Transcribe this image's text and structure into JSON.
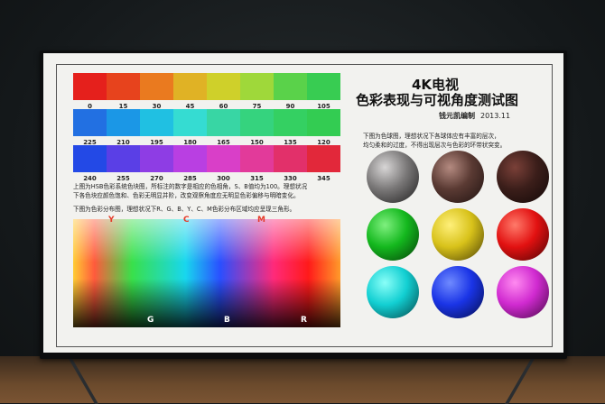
{
  "chart": {
    "title_line1": "4K电视",
    "title_line2": "色彩表现与可视角度测试图",
    "author": "钱元凯编制",
    "date": "2013.11"
  },
  "hue_bars": {
    "row1": {
      "labels": [
        "0",
        "15",
        "30",
        "45",
        "60",
        "75",
        "90",
        "105"
      ],
      "colors": [
        "#e5201c",
        "#e7431d",
        "#ea7a1f",
        "#e0b225",
        "#cfd02a",
        "#9fd83a",
        "#5ad24a",
        "#38cc52"
      ]
    },
    "row2": {
      "labels": [
        "225",
        "210",
        "195",
        "180",
        "165",
        "150",
        "135",
        "120"
      ],
      "colors": [
        "#2270e2",
        "#1b97e6",
        "#20c0e2",
        "#35dcd2",
        "#38d6a4",
        "#35d37e",
        "#34d062",
        "#33cc52"
      ]
    },
    "row3": {
      "labels": [
        "240",
        "255",
        "270",
        "285",
        "300",
        "315",
        "330",
        "345"
      ],
      "colors": [
        "#2349e6",
        "#5a3fe6",
        "#8e3de4",
        "#b93fe2",
        "#d93fc8",
        "#e23a9a",
        "#e2306a",
        "#e2283a"
      ]
    }
  },
  "texts": {
    "hsb_note_1": "上图为HSB色彩系统色块图，所标注的数字是相应的色相角，S、B值均为100。理想状况",
    "hsb_note_2": "下各色块应颜色饱和、色彩无明显并阶，改变观察角度应无明显色彩偏移与明暗变化。",
    "distribution_note": "下图为色彩分布图，理想状况下R、G、B、Y、C、M色彩分布区域均应呈现三角形。",
    "sphere_note_1": "下图为色球图，理想状况下各球体应有丰富的层次，",
    "sphere_note_2": "均匀柔和的过度，不得出现层次与色彩的环带状突变。"
  },
  "distribution_labels": {
    "top": [
      {
        "text": "Y",
        "color": "#e53b2a"
      },
      {
        "text": "C",
        "color": "#e53b2a"
      },
      {
        "text": "M",
        "color": "#e53b2a"
      }
    ],
    "bottom": [
      {
        "text": "G",
        "color": "#ffffff"
      },
      {
        "text": "B",
        "color": "#ffffff"
      },
      {
        "text": "R",
        "color": "#ffffff"
      }
    ]
  },
  "spheres": {
    "colors": [
      [
        "#d8d6d6",
        "#7a7878",
        "#1e1d1d"
      ],
      [
        "#b48a80",
        "#5a3a33",
        "#1f1210"
      ],
      [
        "#7a4038",
        "#3b1e1a",
        "#120807"
      ],
      [
        "#7ff07f",
        "#14b81e",
        "#053c08"
      ],
      [
        "#fff07a",
        "#d8c21a",
        "#4a3f05"
      ],
      [
        "#ff7a6a",
        "#e21111",
        "#4a0303"
      ],
      [
        "#8afff8",
        "#12cfd2",
        "#044446"
      ],
      [
        "#6f8aff",
        "#1a34e6",
        "#050d4a"
      ],
      [
        "#ff8af0",
        "#d02ad0",
        "#470845"
      ]
    ]
  }
}
